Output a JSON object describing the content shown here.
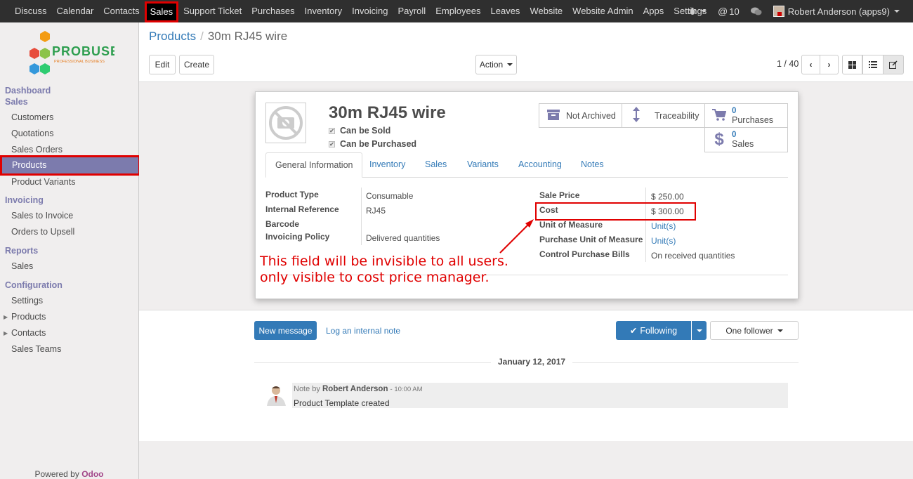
{
  "topbar": {
    "menu": [
      "Discuss",
      "Calendar",
      "Contacts",
      "Sales",
      "Support Ticket",
      "Purchases",
      "Inventory",
      "Invoicing",
      "Payroll",
      "Employees",
      "Leaves",
      "Website",
      "Website Admin",
      "Apps",
      "Settings"
    ],
    "active_menu": "Sales",
    "notifications_count": "10",
    "user": "Robert Anderson (apps9)"
  },
  "sidebar": {
    "logo_text": "PROBUSE",
    "logo_subtext": "PROFESSIONAL BUSINESS",
    "dashboard": "Dashboard",
    "sales_section": "Sales",
    "sales_items": [
      "Customers",
      "Quotations",
      "Sales Orders",
      "Products",
      "Product Variants"
    ],
    "invoicing_section": "Invoicing",
    "invoicing_items": [
      "Sales to Invoice",
      "Orders to Upsell"
    ],
    "reports_section": "Reports",
    "reports_items": [
      "Sales"
    ],
    "configuration_section": "Configuration",
    "configuration_items": [
      "Settings",
      "Products",
      "Contacts",
      "Sales Teams"
    ],
    "powered_by": "Powered by",
    "powered_brand": "Odoo"
  },
  "breadcrumb": {
    "parent": "Products",
    "current": "30m RJ45 wire"
  },
  "toolbar": {
    "edit": "Edit",
    "create": "Create",
    "action": "Action",
    "pager": "1 / 40"
  },
  "product": {
    "name": "30m RJ45 wire",
    "can_be_sold": "Can be Sold",
    "can_be_purchased": "Can be Purchased"
  },
  "smart_buttons": {
    "archived": "Not Archived",
    "traceability": "Traceability",
    "purchases_count": "0",
    "purchases_label": "Purchases",
    "sales_count": "0",
    "sales_label": "Sales"
  },
  "tabs": [
    "General Information",
    "Inventory",
    "Sales",
    "Variants",
    "Accounting",
    "Notes"
  ],
  "fields_left": {
    "product_type_label": "Product Type",
    "product_type": "Consumable",
    "internal_ref_label": "Internal Reference",
    "internal_ref": "RJ45",
    "barcode_label": "Barcode",
    "invoicing_policy_label": "Invoicing Policy",
    "invoicing_policy": "Delivered quantities"
  },
  "fields_right": {
    "sale_price_label": "Sale Price",
    "sale_price": "$ 250.00",
    "cost_label": "Cost",
    "cost": "$ 300.00",
    "uom_label": "Unit of Measure",
    "uom": "Unit(s)",
    "purchase_uom_label": "Purchase Unit of Measure",
    "purchase_uom": "Unit(s)",
    "control_bills_label": "Control Purchase Bills",
    "control_bills": "On received quantities"
  },
  "annotation": {
    "line1": "This field will be invisible to all users.",
    "line2": "only visible to cost price manager."
  },
  "chatter": {
    "new_message": "New message",
    "log_note": "Log an internal note",
    "following": "Following",
    "followers": "One follower",
    "date": "January 12, 2017",
    "msg_prefix": "Note by",
    "msg_author": "Robert Anderson",
    "msg_time": "- 10:00 AM",
    "msg_body": "Product Template created"
  },
  "colors": {
    "accent": "#7c7bad",
    "link": "#337ab7",
    "highlight": "#e00000",
    "topbar": "#2f2f2f"
  }
}
